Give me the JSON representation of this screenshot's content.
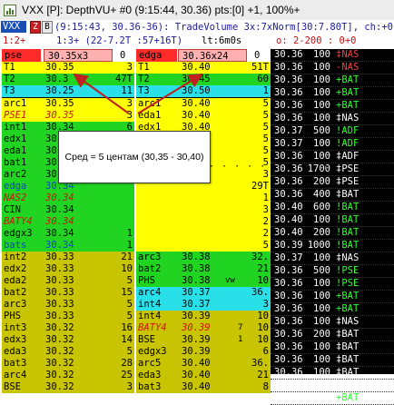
{
  "window": {
    "title": "VXX [P]: DepthVU+ #0 (9:15:44, 30.36) pts:[0] +1, 100%+"
  },
  "infobar": {
    "symbol": "VXX",
    "flag_z": "Z",
    "flag_b": "B",
    "text": "(9:15:43, 30.36-36): TradeVolume 3x:7xNorm[30:7.80T], ch:+0.89"
  },
  "stats": {
    "position": "1:2+",
    "trades": "1:3+ (22-7.2T :57+16T)",
    "time": "lt:6m0s",
    "orders": "o: 2-200 : 0+0"
  },
  "bid_header": {
    "venue": "pse",
    "quote": "30.35x3",
    "size": "0"
  },
  "ask_header": {
    "venue": "edga",
    "quote": "30.36x24",
    "size": "0"
  },
  "callout": {
    "text": "Сред = 5 центам (30,35 - 30,40)"
  },
  "colors": {
    "yellow": "#ffff00",
    "green": "#21d421",
    "cyan": "#29e0e8",
    "olive": "#c9c400",
    "tape_bg": "#000000",
    "tape_green": "#2cff2c",
    "tape_red": "#ff3b3b",
    "tape_white": "#ffffff"
  },
  "bid_rows": [
    {
      "name": "T1",
      "price": "30.35",
      "size": "3",
      "style": "yellow"
    },
    {
      "name": "T2",
      "price": "30.3",
      "size": "47T",
      "style": "green"
    },
    {
      "name": "T3",
      "price": "30.25",
      "size": "11",
      "style": "cyan"
    },
    {
      "name": "arc1",
      "price": "30.35",
      "size": "3",
      "style": "yellow"
    },
    {
      "name": "PSE1",
      "price": "30.35",
      "size": "3",
      "style": "yellow-red"
    },
    {
      "name": "int1",
      "price": "30.34",
      "size": "6",
      "style": "green"
    },
    {
      "name": "edx1",
      "price": "30.34",
      "size": "6",
      "style": "green"
    },
    {
      "name": "eda1",
      "price": "30.34",
      "size": "6",
      "style": "green"
    },
    {
      "name": "bat1",
      "price": "30.34",
      "size": "6",
      "style": "green"
    },
    {
      "name": "arc2",
      "price": "30.34",
      "size": "6",
      "style": "green"
    },
    {
      "name": "edga",
      "price": "30.34",
      "size": "",
      "style": "green-blue"
    },
    {
      "name": "NAS2",
      "price": "30.34",
      "size": "",
      "style": "green-red"
    },
    {
      "name": "CIN",
      "price": "30.34",
      "size": "",
      "style": "green"
    },
    {
      "name": "BATY4",
      "price": "30.34",
      "size": "",
      "style": "green-red"
    },
    {
      "name": "edgx3",
      "price": "30.34",
      "size": "1",
      "style": "green"
    },
    {
      "name": "bats",
      "price": "30.34",
      "size": "1",
      "style": "green-blue"
    },
    {
      "name": "int2",
      "price": "30.33",
      "size": "21",
      "style": "olive"
    },
    {
      "name": "edx2",
      "price": "30.33",
      "size": "10",
      "style": "olive"
    },
    {
      "name": "eda2",
      "price": "30.33",
      "size": "5",
      "style": "olive"
    },
    {
      "name": "bat2",
      "price": "30.33",
      "size": "15",
      "style": "olive"
    },
    {
      "name": "arc3",
      "price": "30.33",
      "size": "5",
      "style": "olive"
    },
    {
      "name": "PHS",
      "price": "30.33",
      "size": "5",
      "style": "olive"
    },
    {
      "name": "int3",
      "price": "30.32",
      "size": "16",
      "style": "olive"
    },
    {
      "name": "edx3",
      "price": "30.32",
      "size": "14",
      "style": "olive"
    },
    {
      "name": "eda3",
      "price": "30.32",
      "size": "5",
      "style": "olive"
    },
    {
      "name": "bat3",
      "price": "30.32",
      "size": "28",
      "style": "olive"
    },
    {
      "name": "arc4",
      "price": "30.32",
      "size": "25",
      "style": "olive"
    },
    {
      "name": "BSE",
      "price": "30.32",
      "size": "3",
      "style": "olive"
    }
  ],
  "ask_rows": [
    {
      "name": "T1",
      "price": "30.40",
      "size": "51T",
      "style": "yellow"
    },
    {
      "name": "T2",
      "price": "30.45",
      "size": "60",
      "style": "green"
    },
    {
      "name": "T3",
      "price": "30.50",
      "size": "1",
      "style": "cyan"
    },
    {
      "name": "arc1",
      "price": "30.40",
      "size": "5",
      "style": "yellow"
    },
    {
      "name": "eda1",
      "price": "30.40",
      "size": "5",
      "style": "yellow"
    },
    {
      "name": "edx1",
      "price": "30.40",
      "size": "5",
      "style": "yellow"
    },
    {
      "name": "CIN",
      "price": "30.40",
      "size": "5",
      "style": "yellow"
    },
    {
      "name": "NAS2",
      "price": "30.40",
      "size": "5",
      "style": "yellow-red"
    },
    {
      "name": "",
      "price": "",
      "size": "5",
      "style": "yellow"
    },
    {
      "name": "",
      "price": "",
      "size": "3",
      "style": "yellow"
    },
    {
      "name": "",
      "price": "",
      "size": "29T",
      "style": "yellow"
    },
    {
      "name": "",
      "price": "",
      "size": "1",
      "style": "yellow"
    },
    {
      "name": "",
      "price": "",
      "size": "3",
      "style": "yellow"
    },
    {
      "name": "",
      "price": "",
      "size": "2",
      "style": "yellow"
    },
    {
      "name": "",
      "price": "",
      "size": "2",
      "style": "yellow"
    },
    {
      "name": "",
      "price": "",
      "size": "5",
      "style": "yellow"
    },
    {
      "name": "arc3",
      "price": "30.38",
      "size": "32.",
      "style": "green"
    },
    {
      "name": "bat2",
      "price": "30.38",
      "size": "21",
      "style": "green"
    },
    {
      "name": "PHS",
      "price": "30.38",
      "size": "10",
      "style": "green"
    },
    {
      "name": "arc4",
      "price": "30.37",
      "size": "36.",
      "style": "cyan"
    },
    {
      "name": "int4",
      "price": "30.37",
      "size": "3",
      "style": "cyan"
    },
    {
      "name": "int4",
      "price": "30.39",
      "size": "10",
      "style": "olive"
    },
    {
      "name": "BATY4",
      "price": "30.39",
      "size": "10",
      "style": "olive-red"
    },
    {
      "name": "BSE",
      "price": "30.39",
      "size": "10",
      "style": "olive"
    },
    {
      "name": "edgx3",
      "price": "30.39",
      "size": "6",
      "style": "olive"
    },
    {
      "name": "arc5",
      "price": "30.40",
      "size": "36.",
      "style": "olive"
    },
    {
      "name": "eda3",
      "price": "30.40",
      "size": "21",
      "style": "olive"
    },
    {
      "name": "bat3",
      "price": "30.40",
      "size": "8",
      "style": "olive"
    }
  ],
  "ask_extras": {
    "r18": "vw",
    "r22": "7",
    "r23": "1"
  },
  "tape": [
    {
      "price": "30.36",
      "size": "100",
      "venue": "‡NAS",
      "color": "red"
    },
    {
      "price": "30.36",
      "size": "100",
      "venue": "-NAS",
      "color": "red"
    },
    {
      "price": "30.36",
      "size": "100",
      "venue": "+BAT",
      "color": "green"
    },
    {
      "price": "30.36",
      "size": "100",
      "venue": "+BAT",
      "color": "green"
    },
    {
      "price": "30.36",
      "size": "100",
      "venue": "+BAT",
      "color": "green"
    },
    {
      "price": "30.36",
      "size": "100",
      "venue": "‡NAS",
      "color": "white"
    },
    {
      "price": "30.37",
      "size": "500",
      "venue": "!ADF",
      "color": "green"
    },
    {
      "price": "30.37",
      "size": "100",
      "venue": "!ADF",
      "color": "green"
    },
    {
      "price": "30.36",
      "size": "100",
      "venue": "‡ADF",
      "color": "white"
    },
    {
      "price": "30.36",
      "size": "1700",
      "venue": "‡PSE",
      "color": "white"
    },
    {
      "price": "30.36",
      "size": "200",
      "venue": "‡PSE",
      "color": "white"
    },
    {
      "price": "30.36",
      "size": "400",
      "venue": "‡BAT",
      "color": "white"
    },
    {
      "price": "30.40",
      "size": "600",
      "venue": "!BAT",
      "color": "green"
    },
    {
      "price": "30.40",
      "size": "100",
      "venue": "!BAT",
      "color": "green"
    },
    {
      "price": "30.40",
      "size": "200",
      "venue": "!BAT",
      "color": "green"
    },
    {
      "price": "30.39",
      "size": "1000",
      "venue": "!BAT",
      "color": "green"
    },
    {
      "price": "30.37",
      "size": "100",
      "venue": "‡NAS",
      "color": "white"
    },
    {
      "price": "30.36",
      "size": "500",
      "venue": "!PSE",
      "color": "green"
    },
    {
      "price": "30.36",
      "size": "100",
      "venue": "!PSE",
      "color": "green"
    },
    {
      "price": "30.36",
      "size": "100",
      "venue": "+BAT",
      "color": "green"
    },
    {
      "price": "30.36",
      "size": "100",
      "venue": "+BAT",
      "color": "green"
    },
    {
      "price": "30.36",
      "size": "100",
      "venue": "‡NAS",
      "color": "white"
    },
    {
      "price": "30.36",
      "size": "200",
      "venue": "‡BAT",
      "color": "white"
    },
    {
      "price": "30.36",
      "size": "100",
      "venue": "‡BAT",
      "color": "white"
    },
    {
      "price": "30.36",
      "size": "100",
      "venue": "‡BAT",
      "color": "white"
    },
    {
      "price": "30.36",
      "size": "100",
      "venue": "‡BAT",
      "color": "white"
    },
    {
      "price": "30.36",
      "size": "100",
      "venue": "‡NAS",
      "color": "white"
    },
    {
      "price": "30.36",
      "size": "100",
      "venue": "+BAT",
      "color": "green"
    }
  ]
}
